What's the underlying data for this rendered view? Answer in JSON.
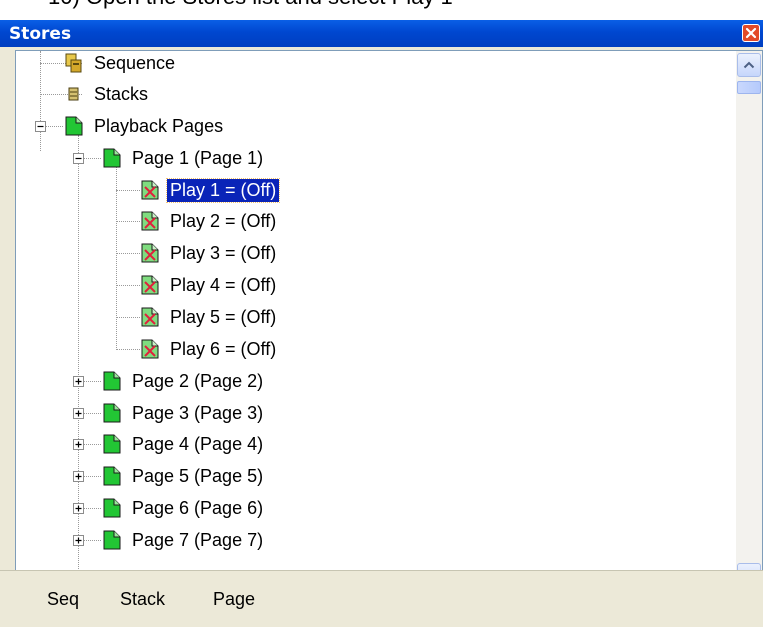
{
  "caption": "10) Open the Stores list and select Play 1",
  "window": {
    "title": "Stores"
  },
  "tree": {
    "sequence": "Sequence",
    "stacks": "Stacks",
    "playback_pages": "Playback Pages",
    "page1": "Page 1 (Page 1)",
    "plays": [
      "Play 1 = (Off)",
      "Play 2 = (Off)",
      "Play 3 = (Off)",
      "Play 4 = (Off)",
      "Play 5 = (Off)",
      "Play 6 = (Off)"
    ],
    "pages": [
      "Page 2 (Page 2)",
      "Page 3 (Page 3)",
      "Page 4 (Page 4)",
      "Page 5 (Page 5)",
      "Page 6 (Page 6)",
      "Page 7 (Page 7)"
    ],
    "selected": "Play 1 = (Off)"
  },
  "tabs": [
    "Seq",
    "Stack",
    "Page"
  ],
  "colors": {
    "titlebar": "#0047d0",
    "selection": "#0a24b8",
    "page_icon": "#22c634",
    "play_icon": "#7fdc7f",
    "play_icon_cross": "#e0203c"
  },
  "icons": {
    "sequence": "sequence-icon",
    "stacks": "stack-icon",
    "page": "page-icon",
    "play": "play-icon",
    "close": "close-icon",
    "scroll_up": "scroll-up-icon",
    "scroll_down": "scroll-down-icon"
  }
}
